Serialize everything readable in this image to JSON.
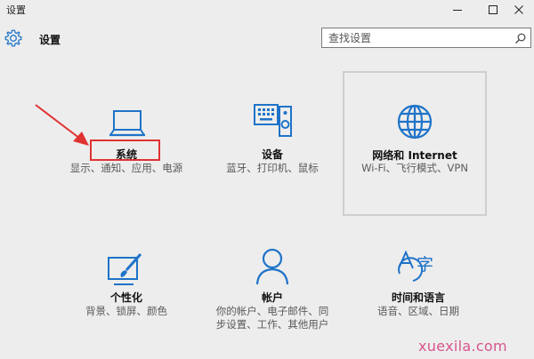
{
  "window": {
    "title": "设置",
    "buttons": [
      "minimize",
      "maximize",
      "close"
    ]
  },
  "header": {
    "icon": "gear-icon",
    "title": "设置"
  },
  "search": {
    "placeholder": "查找设置",
    "icon": "search-icon"
  },
  "tiles": [
    {
      "key": "system",
      "label": "系统",
      "desc": "显示、通知、应用、电源",
      "icon": "laptop-icon",
      "highlighted": true
    },
    {
      "key": "devices",
      "label": "设备",
      "desc": "蓝牙、打印机、鼠标",
      "icon": "devices-icon"
    },
    {
      "key": "network",
      "label": "网络和 Internet",
      "desc": "Wi-Fi、飞行模式、VPN",
      "icon": "globe-icon",
      "selected": true
    },
    {
      "key": "personalization",
      "label": "个性化",
      "desc": "背景、锁屏、颜色",
      "icon": "personalization-icon"
    },
    {
      "key": "accounts",
      "label": "帐户",
      "desc": "你的帐户、电子邮件、同步设置、工作、其他用户",
      "icon": "person-icon"
    },
    {
      "key": "time_language",
      "label": "时间和语言",
      "desc": "语音、区域、日期",
      "icon": "time-language-icon"
    }
  ],
  "colors": {
    "accent": "#1e73c8",
    "highlight": "#e03232",
    "background": "#ededed"
  },
  "watermark": "xuexila.com"
}
